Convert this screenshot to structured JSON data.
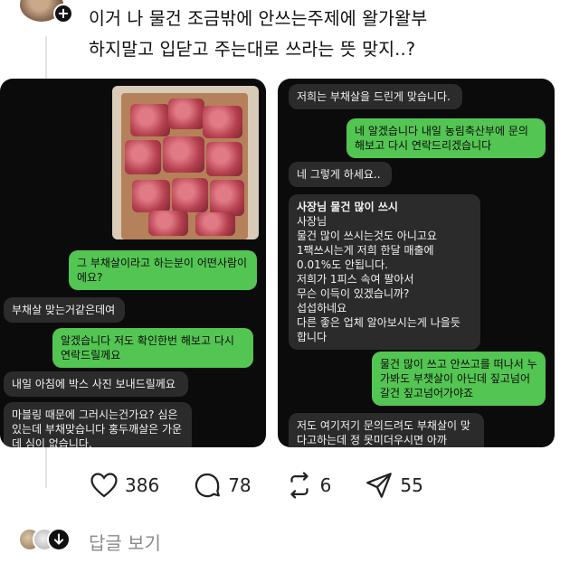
{
  "post": {
    "text_line1": "이거 나 물건 조금밖에 안쓰는주제에 왈가왈부",
    "text_line2": "하지말고 입닫고 주는대로 쓰라는 뜻 맞지..?",
    "follow_icon": "plus-icon"
  },
  "left_chat": {
    "b1": "그 부채살이라고 하는분이 어떤사람이에요?",
    "b2": "부채살 맞는거같은데여",
    "b3": "알겠습니다 저도 확인한번 해보고 다시 연락드릴께요",
    "b4": "내일 아침에 박스 사진 보내드릴께요",
    "b5": "마블링 때문에 그러시는건가요? 심은 있는데 부채맞습니다 홍두깨살은 가운데 심이 없습니다."
  },
  "right_chat": {
    "b1": "저희는 부채살을 드린게 맞습니다.",
    "b2": "네 알겠습니다 내일 농림축산부에 문의해보고 다시 연락드리겠습니다",
    "b3": "네 그렇게 하세요..",
    "b4_title": "사장님  물건 많이 쓰시",
    "b4_body": "사장님\n물건 많이 쓰시는것도 아니고요\n1팩쓰시는게 저희 한달 매출에\n0.01%도 안됩니다.\n저희가 1피스 속여 팔아서\n무슨 이득이 있겠습니까?\n섭섭하네요\n다른 좋은 업체 알아보시는게 나을듯\n합니다",
    "b5": "물건 많이 쓰고 안쓰고를 떠나서 누가봐도 부챗살이 아닌데 짚고넘어갈건 짚고넘어가야죠",
    "b6": "저도 여기저기 문의드려도 부채살이 맞다고하는데 정 못미더우시면 아까"
  },
  "actions": {
    "likes": "386",
    "comments": "78",
    "reposts": "6",
    "shares": "55"
  },
  "footer": {
    "view_replies": "답글 보기"
  },
  "colors": {
    "green_bubble": "#53c552",
    "gray_bubble": "#2b2b2b",
    "screenshot_bg": "#0b0b0b"
  }
}
